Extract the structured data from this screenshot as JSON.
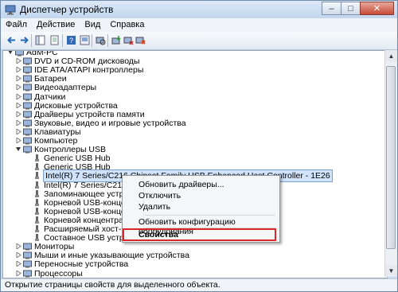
{
  "window": {
    "title": "Диспетчер устройств",
    "buttons": {
      "minimize": "–",
      "maximize": "□",
      "close": "✕"
    }
  },
  "menu": [
    "Файл",
    "Действие",
    "Вид",
    "Справка"
  ],
  "tree": [
    {
      "label": "AdM-PC",
      "level": 0,
      "state": "expanded",
      "icon": "computer-icon"
    },
    {
      "label": "DVD и CD-ROM дисководы",
      "level": 1,
      "state": "collapsed",
      "icon": "dvd-drive-icon"
    },
    {
      "label": "IDE ATA/ATAPI контроллеры",
      "level": 1,
      "state": "collapsed",
      "icon": "ide-controller-icon"
    },
    {
      "label": "Батареи",
      "level": 1,
      "state": "collapsed",
      "icon": "battery-icon"
    },
    {
      "label": "Видеоадаптеры",
      "level": 1,
      "state": "collapsed",
      "icon": "display-adapter-icon"
    },
    {
      "label": "Датчики",
      "level": 1,
      "state": "collapsed",
      "icon": "sensor-icon"
    },
    {
      "label": "Дисковые устройства",
      "level": 1,
      "state": "collapsed",
      "icon": "disk-drive-icon"
    },
    {
      "label": "Драйверы устройств памяти",
      "level": 1,
      "state": "collapsed",
      "icon": "memory-driver-icon"
    },
    {
      "label": "Звуковые, видео и игровые устройства",
      "level": 1,
      "state": "collapsed",
      "icon": "sound-icon"
    },
    {
      "label": "Клавиатуры",
      "level": 1,
      "state": "collapsed",
      "icon": "keyboard-icon"
    },
    {
      "label": "Компьютер",
      "level": 1,
      "state": "collapsed",
      "icon": "computer-icon"
    },
    {
      "label": "Контроллеры USB",
      "level": 1,
      "state": "expanded",
      "icon": "usb-icon"
    },
    {
      "label": "Generic USB Hub",
      "level": 2,
      "state": "leaf",
      "icon": "usb-device-icon"
    },
    {
      "label": "Generic USB Hub",
      "level": 2,
      "state": "leaf",
      "icon": "usb-device-icon"
    },
    {
      "label": "Intel(R) 7 Series/C216 Chipset Family USB Enhanced Host Controller - 1E26",
      "level": 2,
      "state": "leaf",
      "icon": "usb-device-icon",
      "selected": true
    },
    {
      "label": "Intel(R) 7 Series/C216 Chipse",
      "level": 2,
      "state": "leaf",
      "icon": "usb-device-icon"
    },
    {
      "label": "Запоминающее устройство",
      "level": 2,
      "state": "leaf",
      "icon": "usb-device-icon"
    },
    {
      "label": "Корневой USB-концентрат",
      "level": 2,
      "state": "leaf",
      "icon": "usb-device-icon"
    },
    {
      "label": "Корневой USB-концентрат",
      "level": 2,
      "state": "leaf",
      "icon": "usb-device-icon"
    },
    {
      "label": "Корневой концентратор Inte",
      "level": 2,
      "state": "leaf",
      "icon": "usb-device-icon"
    },
    {
      "label": "Расширяемый хост-контр",
      "level": 2,
      "state": "leaf",
      "icon": "usb-device-icon"
    },
    {
      "label": "Составное USB устройство",
      "level": 2,
      "state": "leaf",
      "icon": "usb-device-icon"
    },
    {
      "label": "Мониторы",
      "level": 1,
      "state": "collapsed",
      "icon": "monitor-icon"
    },
    {
      "label": "Мыши и иные указывающие устройства",
      "level": 1,
      "state": "collapsed",
      "icon": "mouse-icon"
    },
    {
      "label": "Переносные устройства",
      "level": 1,
      "state": "collapsed",
      "icon": "portable-device-icon"
    },
    {
      "label": "Процессоры",
      "level": 1,
      "state": "collapsed",
      "icon": "processor-icon"
    }
  ],
  "context_menu": [
    "Обновить драйверы...",
    "Отключить",
    "Удалить",
    "Обновить конфигурацию оборудования",
    "Свойства"
  ],
  "status": "Открытие страницы свойств для выделенного объекта.",
  "colors": {
    "highlight_box": "#d8262a",
    "selection": "#cfe3fb"
  }
}
